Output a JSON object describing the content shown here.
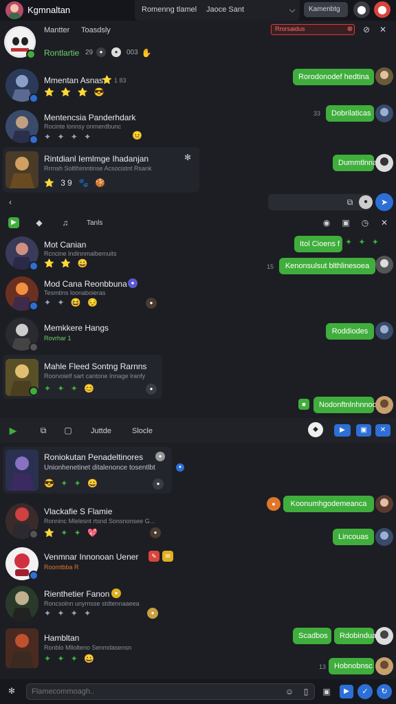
{
  "header": {
    "app_name": "Kgmnaltan",
    "tab1": "Romenng tlamel",
    "tab2": "Jaoce Sant",
    "right_button": "Kamenbtg"
  },
  "subheader": {
    "label1": "Mantter",
    "label2": "Toasdsly",
    "alert": "Rrorsaidus",
    "status_title": "Rontlartie",
    "status_num1": "29",
    "status_num2": "003"
  },
  "section1": {
    "items": [
      {
        "name": "Mmentan Asnas",
        "sub": "",
        "emojis": "⭐ ⭐ ⭐ 😎",
        "badge": "⭐",
        "ts": "1 83"
      },
      {
        "name": "Mentencsia Panderhdark",
        "sub": "Rocinte lonnsy onrnerdbunc",
        "emojis": "✦ ✦ ✦ ✦",
        "ts": ""
      },
      {
        "name": "Rintdianl Iemlmge Ihadanjan",
        "sub": "Rrrnsh Soltlhimntinse Acsocistnt Rsank",
        "emojis": "⭐ 39 🐾 🍪",
        "ts": ""
      }
    ],
    "replies": [
      {
        "text": "Rorodonodef hedtina"
      },
      {
        "text": "Dobrilaticas",
        "ts": "33"
      },
      {
        "text": "Dummtlnna"
      }
    ]
  },
  "toolbar1": {
    "label": "Tanls"
  },
  "section2": {
    "items": [
      {
        "name": "Mot Canian",
        "sub": "Rcncine Indinnmalbemuits",
        "emojis": "⭐ ⭐ 😀"
      },
      {
        "name": "Mod Cana Reonbbuna",
        "sub": "Tesmtins loonaboieras",
        "emojis": "✦ ✦ 😆 😔"
      },
      {
        "name": "Memkkere Hangs",
        "sub": "Rovrhar 1",
        "emojis": ""
      },
      {
        "name": "Mahle Fleed Sontng Rarnns",
        "sub": "Roorvoielf sart cantone Innage lranfy",
        "emojis": "✦ ✦ ✦ 😊"
      }
    ],
    "replies": [
      {
        "text": "Itol Cioens f"
      },
      {
        "text": "Kenonsulsut blthlinesoea",
        "ts": "15"
      },
      {
        "text": "Roddiodes"
      },
      {
        "text": "Nodonftnlnhnnoo"
      }
    ]
  },
  "toolbar2": {
    "label1": "Juttde",
    "label2": "Slocle"
  },
  "section3": {
    "items": [
      {
        "name": "Roniokutan Penadeltinores",
        "sub": "Unionhenetinet ditalenonce tosentlbt",
        "emojis": "😎 ✦ ✦ 😀"
      },
      {
        "name": "Vlackafie S Flamie",
        "sub": "Ronninc Mlelesnt rtsnd Sonsnonsee G...",
        "emojis": "⭐ ✦ ✦ 💖"
      },
      {
        "name": "Venmnar Innonoan Uener",
        "sub": "Roomtbba R",
        "emojis": ""
      },
      {
        "name": "Rienthetier Fanon",
        "sub": "Roncsolnn unyrnsse stdtennaaeea",
        "emojis": "✦ ✦ ✦ ✦"
      },
      {
        "name": "Hambltan",
        "sub": "Ronblo Mllolteno Senmdasensn",
        "emojis": "✦ ✦ ✦ 😀"
      }
    ],
    "replies": [
      {
        "text": "Koonumhgodemeanca"
      },
      {
        "text": "Lincouas"
      },
      {
        "text": "Scadbos"
      },
      {
        "text": "Rdobindua"
      },
      {
        "text": "Hobnobnsc",
        "ts": "13"
      }
    ]
  },
  "composer": {
    "placeholder": "Flamecommoagh.."
  },
  "colors": {
    "background": "#1c1e24",
    "accent_green": "#3fae3c",
    "accent_blue": "#2d6fd6",
    "alert_red": "#d93b3b"
  }
}
